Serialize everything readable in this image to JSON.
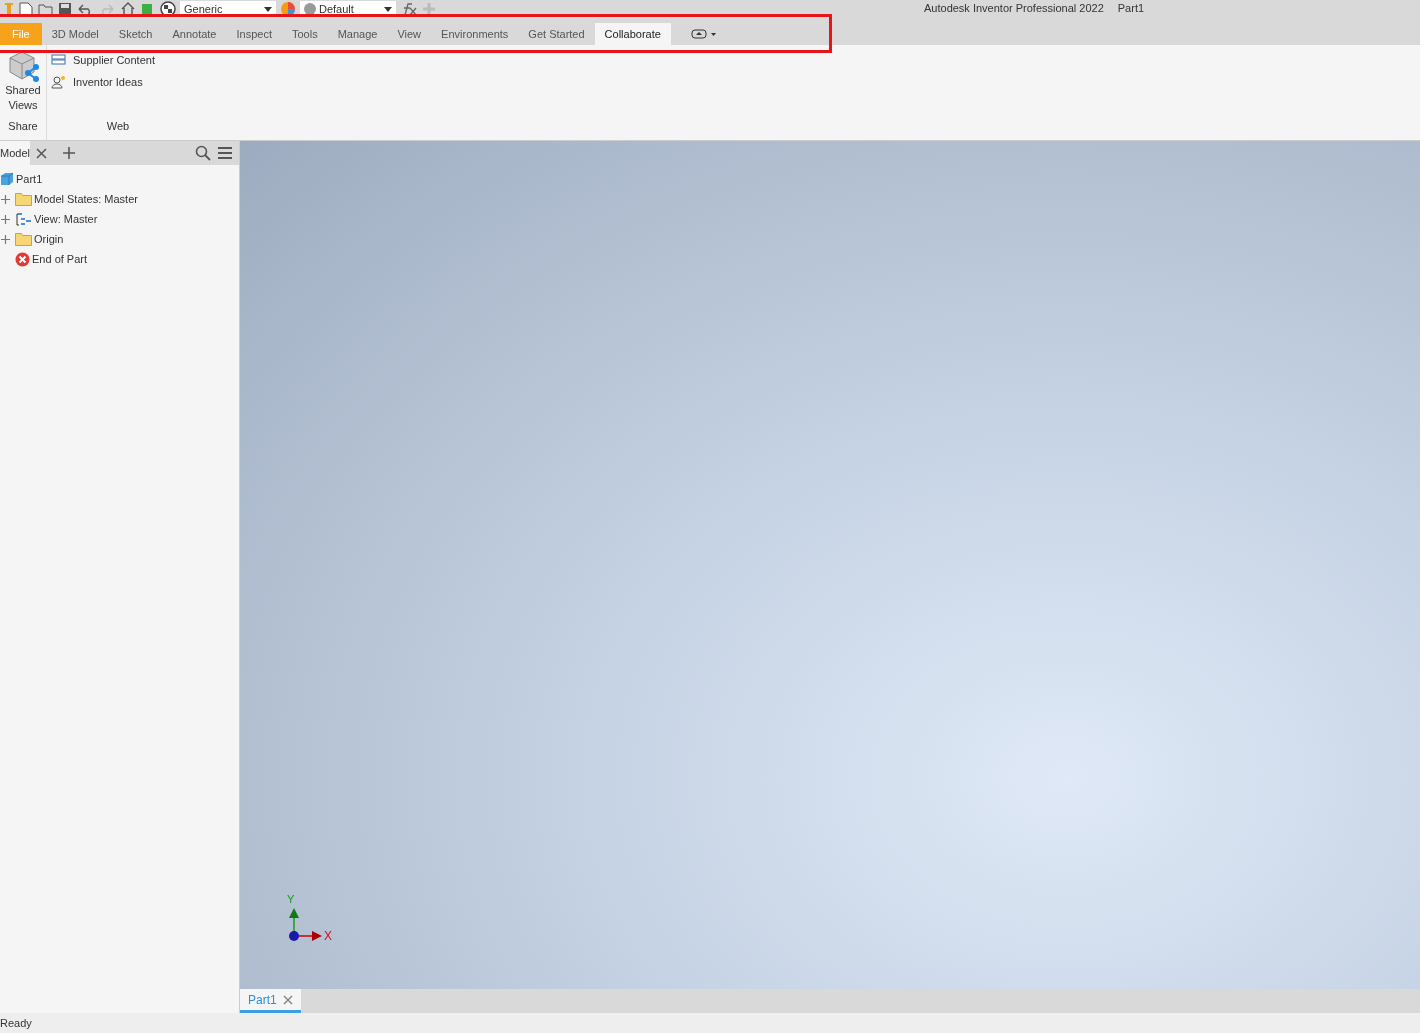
{
  "quick_access": {
    "material": "Generic",
    "appearance": "Default"
  },
  "window": {
    "title": "Autodesk Inventor Professional 2022",
    "document": "Part1"
  },
  "tabs": [
    {
      "label": "File",
      "kind": "file",
      "selected": false
    },
    {
      "label": "3D Model",
      "kind": "tab",
      "selected": false
    },
    {
      "label": "Sketch",
      "kind": "tab",
      "selected": false
    },
    {
      "label": "Annotate",
      "kind": "tab",
      "selected": false
    },
    {
      "label": "Inspect",
      "kind": "tab",
      "selected": false
    },
    {
      "label": "Tools",
      "kind": "tab",
      "selected": false
    },
    {
      "label": "Manage",
      "kind": "tab",
      "selected": false
    },
    {
      "label": "View",
      "kind": "tab",
      "selected": false
    },
    {
      "label": "Environments",
      "kind": "tab",
      "selected": false
    },
    {
      "label": "Get Started",
      "kind": "tab",
      "selected": false
    },
    {
      "label": "Collaborate",
      "kind": "tab",
      "selected": true
    }
  ],
  "ribbon": {
    "panels": [
      {
        "title": "Share",
        "buttons": [
          {
            "label": "Shared Views",
            "kind": "large"
          }
        ]
      },
      {
        "title": "Web",
        "buttons": [
          {
            "label": "Supplier Content",
            "kind": "small"
          },
          {
            "label": "Inventor Ideas",
            "kind": "small"
          }
        ]
      }
    ]
  },
  "browser": {
    "tab": "Model",
    "root": {
      "label": "Part1",
      "children": [
        {
          "label": "Model States: Master",
          "kind": "folder",
          "expanded": false
        },
        {
          "label": "View: Master",
          "kind": "view",
          "expanded": false
        },
        {
          "label": "Origin",
          "kind": "folder",
          "expanded": false
        },
        {
          "label": "End of Part",
          "kind": "end"
        }
      ]
    }
  },
  "viewport": {
    "axis_x": "X",
    "axis_y": "Y"
  },
  "document_tabs": [
    {
      "label": "Part1",
      "selected": true
    }
  ],
  "status_bar": "Ready"
}
